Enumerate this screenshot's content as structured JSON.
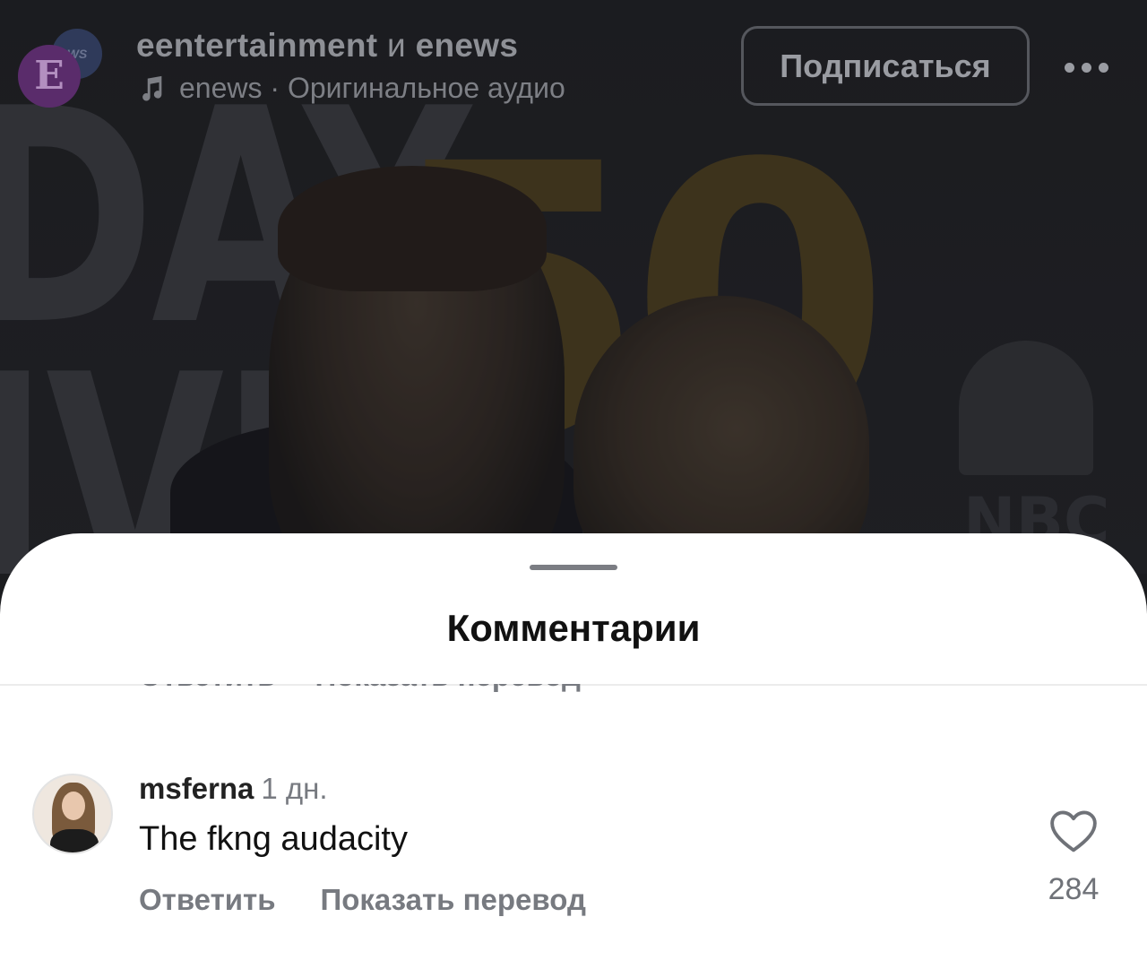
{
  "header": {
    "author_primary": "eentertainment",
    "author_joiner": "и",
    "author_secondary": "enews",
    "audio_label": "enews · Оригинальное аудио",
    "follow_label": "Подписаться",
    "avatar_letter": "E",
    "avatar_back_label": "WS"
  },
  "video_backdrop": {
    "text_left": "DAY\nIVE",
    "text_gold": "50",
    "network": "NBC"
  },
  "sheet": {
    "title": "Комментарии",
    "partial_row": {
      "reply_label": "Ответить",
      "translate_label": "Показать перевод"
    },
    "comments": [
      {
        "username": "msferna",
        "time": "1 дн.",
        "text": "The fkng audacity",
        "reply_label": "Ответить",
        "translate_label": "Показать перевод",
        "likes": "284"
      }
    ]
  },
  "colors": {
    "sheet_bg": "#ffffff",
    "secondary_text": "#777a80",
    "primary_text": "#111111"
  },
  "icons": [
    "music-note-icon",
    "more-options-icon",
    "heart-icon"
  ]
}
